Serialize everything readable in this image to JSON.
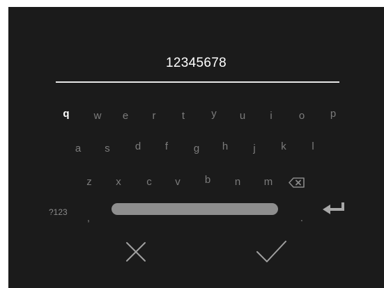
{
  "input": {
    "value": "12345678"
  },
  "keyboard": {
    "row1": [
      "q",
      "w",
      "e",
      "r",
      "t",
      "y",
      "u",
      "i",
      "o",
      "p"
    ],
    "row2": [
      "a",
      "s",
      "d",
      "f",
      "g",
      "h",
      "j",
      "k",
      "l"
    ],
    "row3": [
      "z",
      "x",
      "c",
      "v",
      "b",
      "n",
      "m"
    ],
    "mode_switch_label": "?123",
    "comma": ",",
    "period": ".",
    "active_key": "q"
  },
  "icons": {
    "backspace": "backspace-icon",
    "enter": "enter-icon",
    "cancel": "close-icon",
    "confirm": "checkmark-icon"
  },
  "colors": {
    "background": "#1b1b1b",
    "text_active": "#ffffff",
    "text_inactive": "#7c7c7c",
    "spacebar": "#8e8e8e"
  }
}
